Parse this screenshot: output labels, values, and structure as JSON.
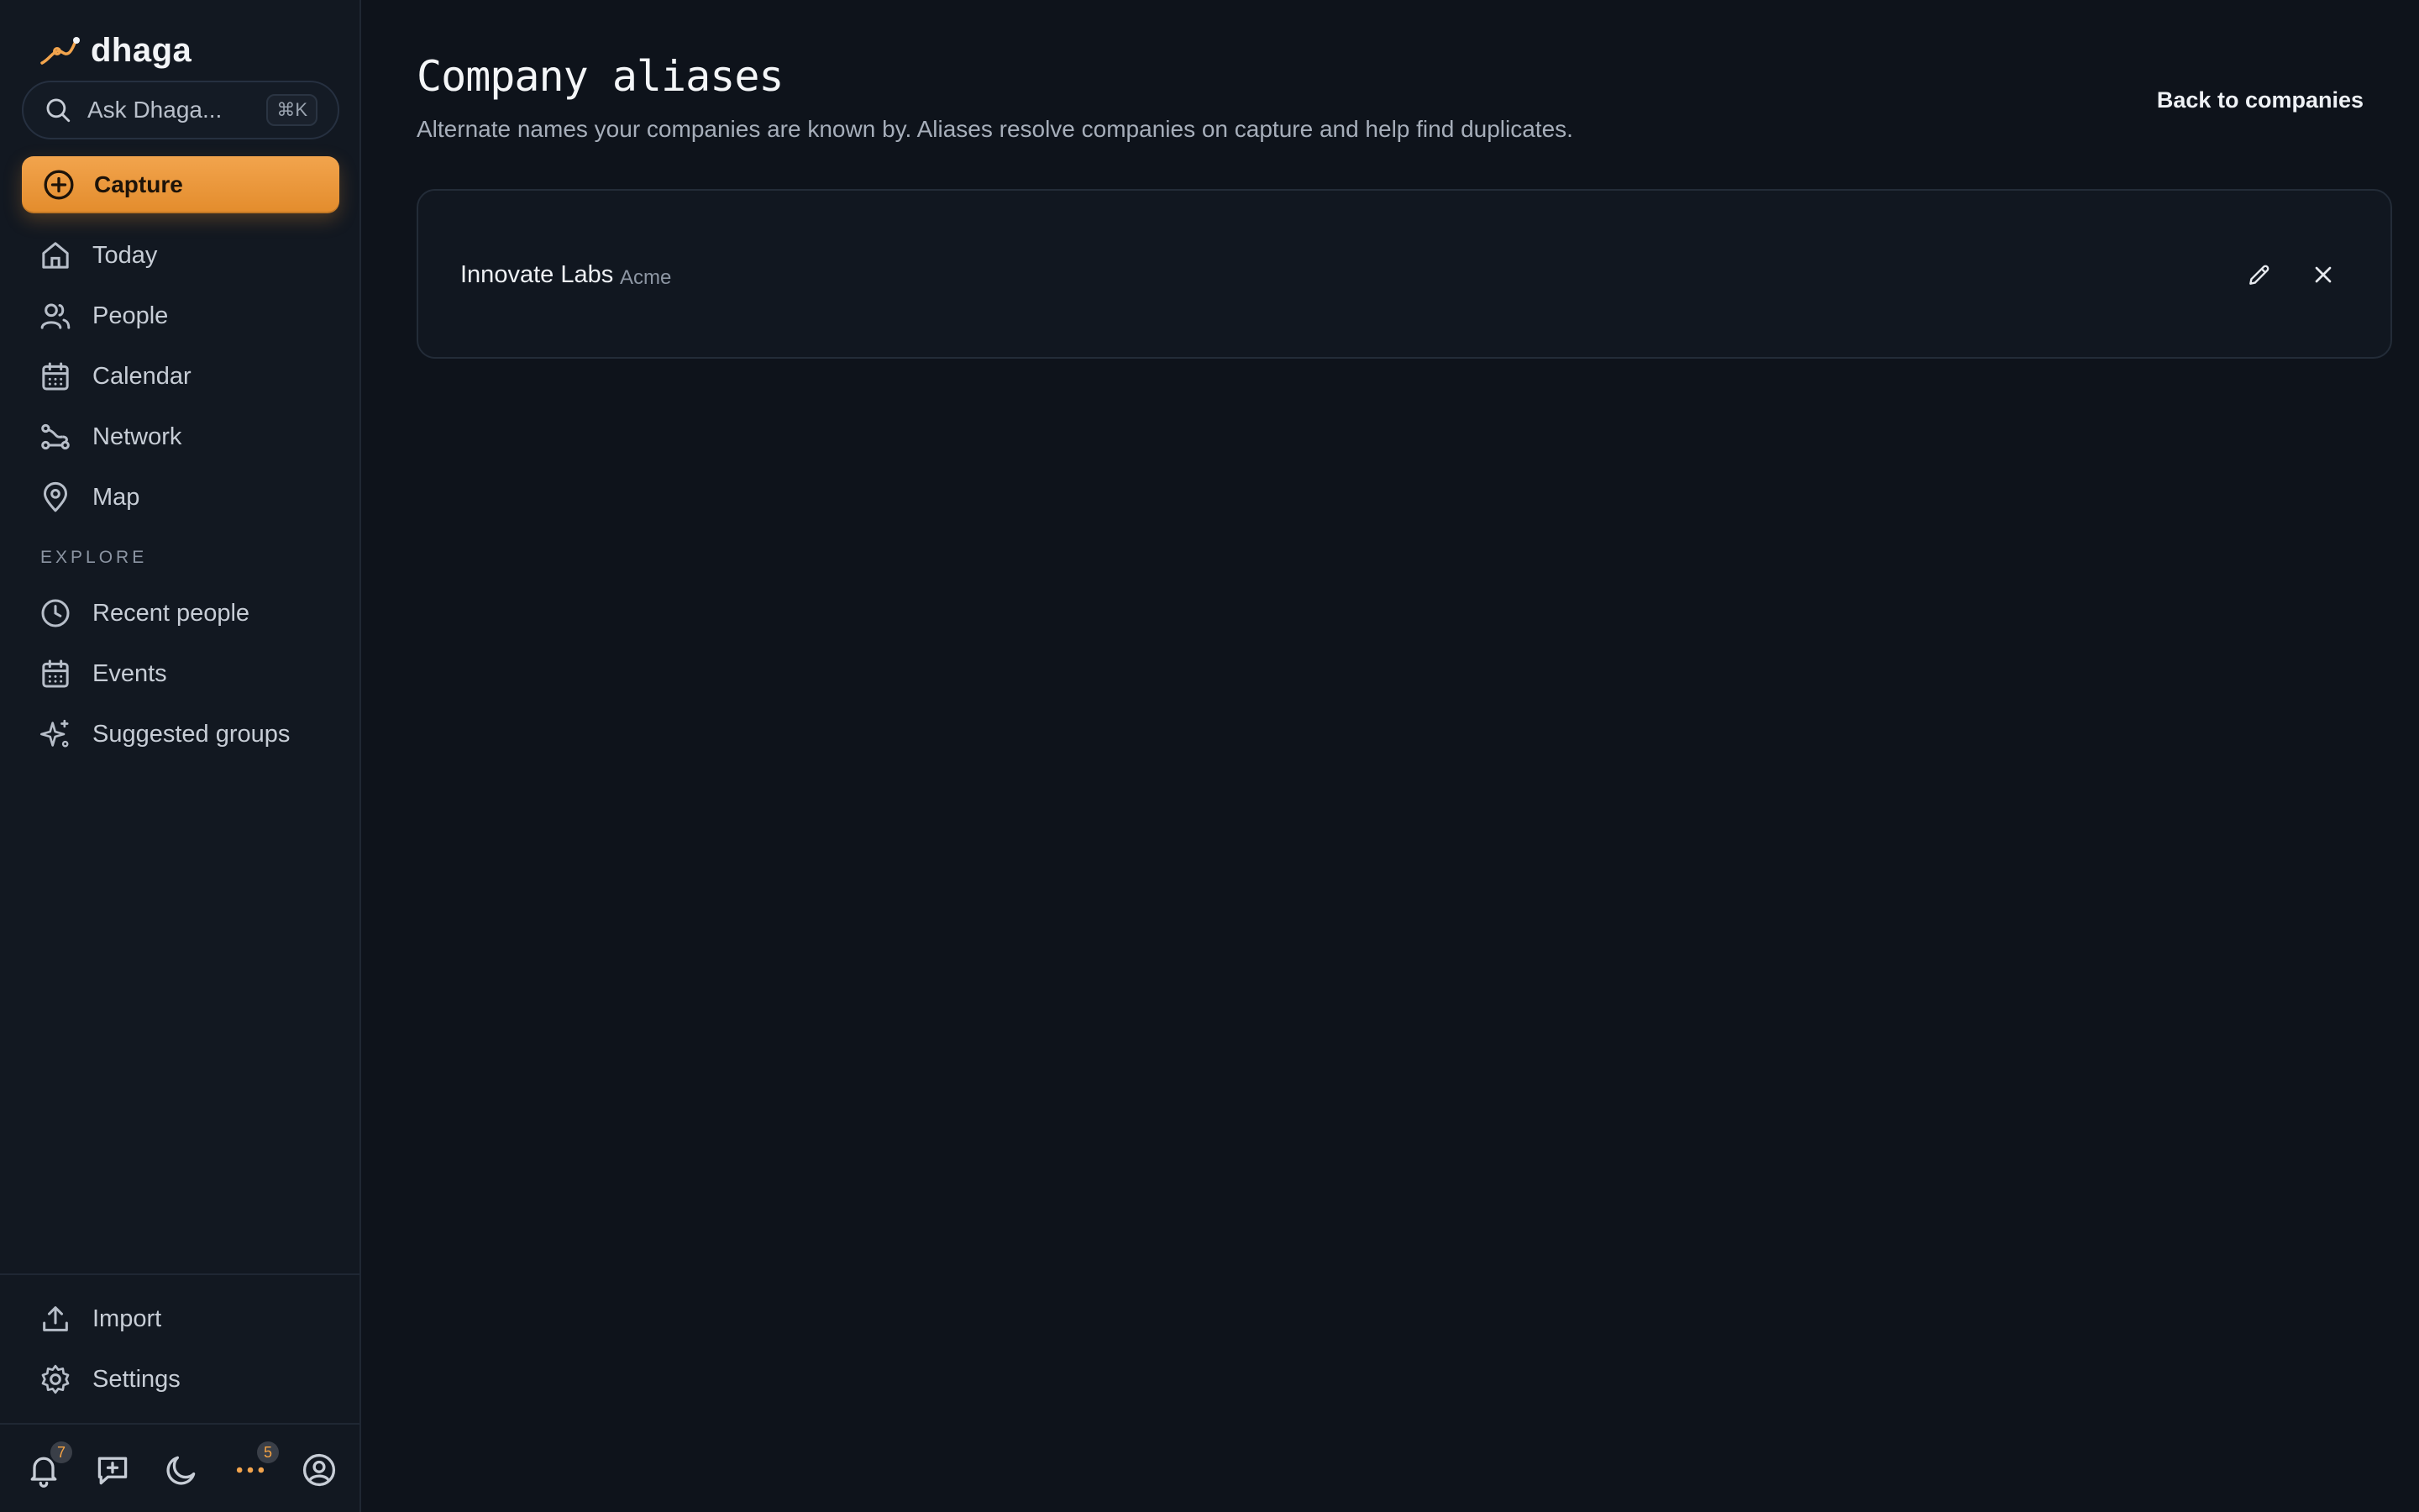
{
  "brand": {
    "name": "dhaga"
  },
  "search": {
    "placeholder": "Ask Dhaga...",
    "shortcut": "⌘K"
  },
  "capture": {
    "label": "Capture"
  },
  "nav": {
    "items": [
      {
        "label": "Today",
        "icon": "home-icon"
      },
      {
        "label": "People",
        "icon": "people-icon"
      },
      {
        "label": "Calendar",
        "icon": "calendar-icon"
      },
      {
        "label": "Network",
        "icon": "network-icon"
      },
      {
        "label": "Map",
        "icon": "map-pin-icon"
      }
    ]
  },
  "explore": {
    "label": "EXPLORE",
    "items": [
      {
        "label": "Recent people",
        "icon": "clock-icon"
      },
      {
        "label": "Events",
        "icon": "calendar-icon"
      },
      {
        "label": "Suggested groups",
        "icon": "sparkles-icon"
      }
    ]
  },
  "footer_nav": {
    "items": [
      {
        "label": "Import",
        "icon": "upload-icon"
      },
      {
        "label": "Settings",
        "icon": "gear-icon"
      }
    ]
  },
  "bottom_bar": {
    "notifications_count": "7",
    "more_count": "5",
    "icons": [
      "bell-icon",
      "chat-plus-icon",
      "moon-icon",
      "more-icon",
      "user-circle-icon"
    ]
  },
  "colors": {
    "accent": "#f2a44d",
    "background": "#0e131b",
    "sidebar": "#121821"
  },
  "page": {
    "title": "Company aliases",
    "subtitle": "Alternate names your companies are known by. Aliases resolve companies on capture and help find duplicates.",
    "back_link": "Back to companies"
  },
  "aliases": [
    {
      "company": "Innovate Labs",
      "alias": "Acme"
    }
  ]
}
